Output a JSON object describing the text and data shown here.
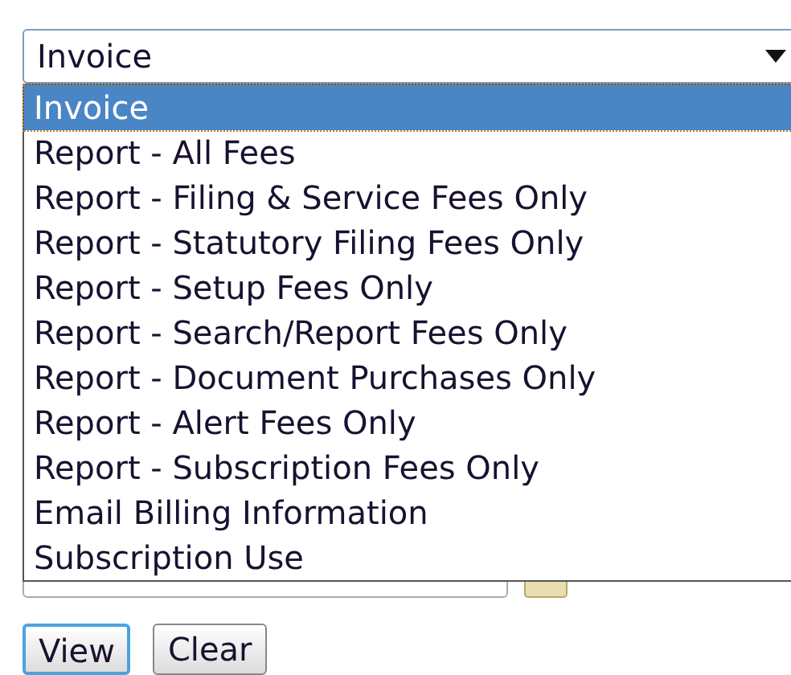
{
  "select": {
    "value": "Invoice",
    "options": [
      {
        "label": "Invoice",
        "selected": true
      },
      {
        "label": "Report - All Fees",
        "selected": false
      },
      {
        "label": "Report - Filing & Service Fees Only",
        "selected": false
      },
      {
        "label": "Report - Statutory Filing Fees Only",
        "selected": false
      },
      {
        "label": "Report - Setup Fees Only",
        "selected": false
      },
      {
        "label": "Report - Search/Report Fees Only",
        "selected": false
      },
      {
        "label": "Report - Document Purchases Only",
        "selected": false
      },
      {
        "label": "Report - Alert Fees Only",
        "selected": false
      },
      {
        "label": "Report - Subscription Fees Only",
        "selected": false
      },
      {
        "label": "Email Billing Information",
        "selected": false
      },
      {
        "label": "Subscription Use",
        "selected": false
      }
    ]
  },
  "buttons": [
    {
      "label": "View",
      "focused": true
    },
    {
      "label": "Clear",
      "focused": false
    }
  ]
}
